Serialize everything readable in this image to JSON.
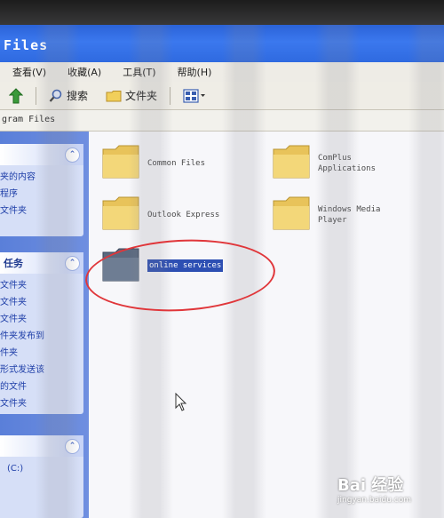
{
  "window": {
    "title": "Files"
  },
  "menu": [
    "查看(V)",
    "收藏(A)",
    "工具(T)",
    "帮助(H)"
  ],
  "toolbar": {
    "search_label": "搜索",
    "folders_label": "文件夹"
  },
  "address": {
    "path": "gram Files"
  },
  "task_pane": {
    "panel1": {
      "items": [
        "夹的内容",
        "程序",
        "文件夹"
      ]
    },
    "panel2": {
      "title": "任务",
      "items": [
        "文件夹",
        "文件夹",
        "文件夹",
        "件夹发布到",
        "件夹",
        "形式发送该",
        "的文件",
        "文件夹"
      ]
    },
    "panel3": {
      "items": [
        "(C:)"
      ]
    }
  },
  "folders": [
    {
      "label": "Common Files"
    },
    {
      "label": "ComPlus\nApplications"
    },
    {
      "label": "Outlook Express"
    },
    {
      "label": "Windows Media\nPlayer"
    },
    {
      "label": "online services",
      "selected": true
    }
  ],
  "watermark": {
    "brand": "Bai 经验",
    "url": "jingyan.baidu.com"
  },
  "colors": {
    "titlebar": "#2f6ae0",
    "selection": "#2d4fb3",
    "annotation": "#e0363a"
  }
}
